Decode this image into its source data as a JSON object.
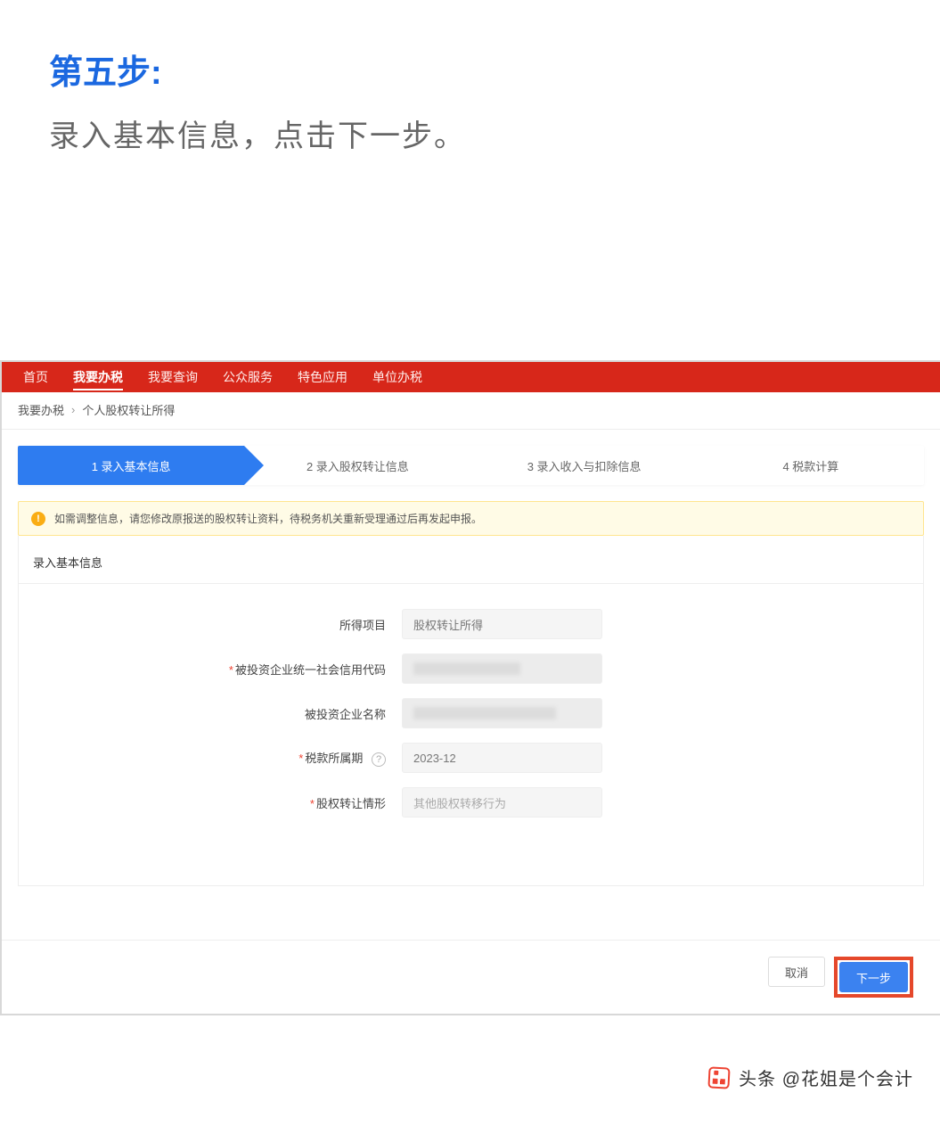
{
  "article": {
    "step_title": "第五步:",
    "step_desc": "录入基本信息，点击下一步。"
  },
  "nav": {
    "items": [
      "首页",
      "我要办税",
      "我要查询",
      "公众服务",
      "特色应用",
      "单位办税"
    ],
    "active_index": 1
  },
  "breadcrumb": {
    "root": "我要办税",
    "sep": "›",
    "current": "个人股权转让所得"
  },
  "steps": [
    "1  录入基本信息",
    "2  录入股权转让信息",
    "3  录入收入与扣除信息",
    "4  税款计算"
  ],
  "alert": {
    "icon": "!",
    "text": "如需调整信息，请您修改原报送的股权转让资料，待税务机关重新受理通过后再发起申报。"
  },
  "panel": {
    "title": "录入基本信息"
  },
  "form": {
    "rows": [
      {
        "label": "所得项目",
        "required": false,
        "value": "股权转让所得",
        "blurred": false,
        "help": false
      },
      {
        "label": "被投资企业统一社会信用代码",
        "required": true,
        "value": "",
        "blurred": true,
        "help": false
      },
      {
        "label": "被投资企业名称",
        "required": false,
        "value": "",
        "blurred": true,
        "help": false
      },
      {
        "label": "税款所属期",
        "required": true,
        "value": "2023-12",
        "blurred": false,
        "help": true
      },
      {
        "label": "股权转让情形",
        "required": true,
        "value": "其他股权转移行为",
        "blurred": false,
        "help": false
      }
    ]
  },
  "actions": {
    "cancel": "取消",
    "next": "下一步"
  },
  "watermark": {
    "text": "头条 @花姐是个会计"
  }
}
